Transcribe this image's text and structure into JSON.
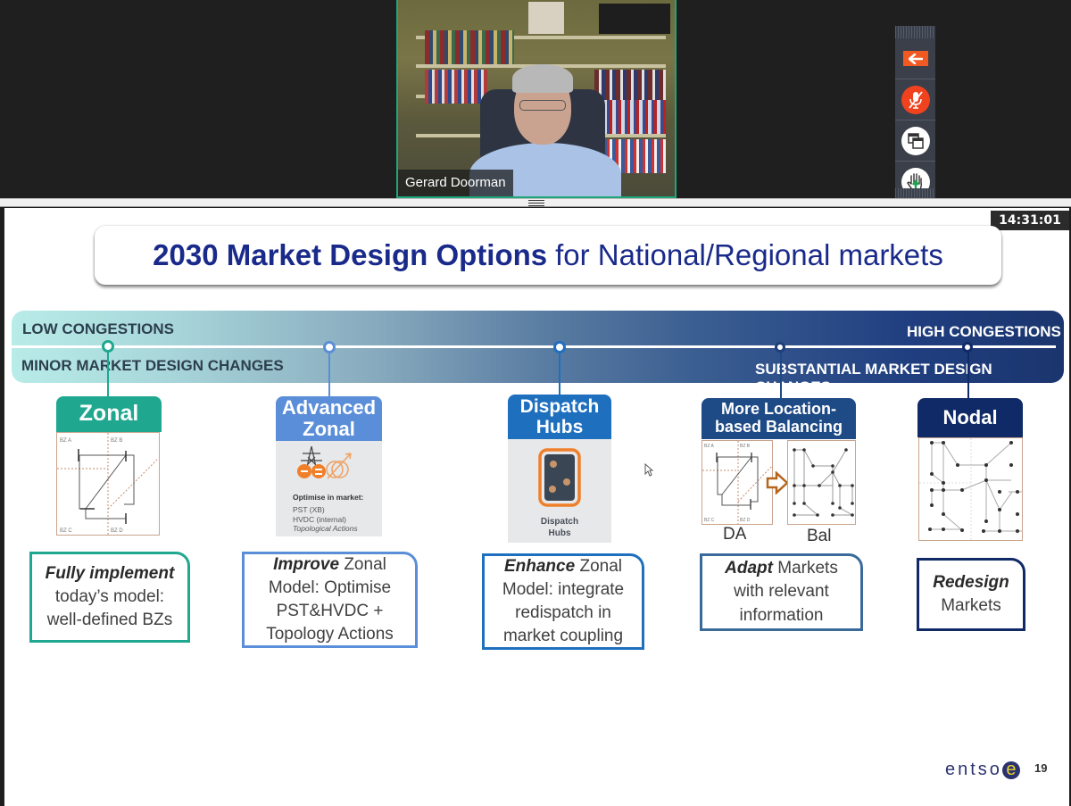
{
  "meeting": {
    "participant_name": "Gerard Doorman",
    "clock": "14:31:01"
  },
  "toolbar": {
    "buttons": [
      {
        "name": "back",
        "icon": "arrow-left-icon"
      },
      {
        "name": "mute",
        "icon": "microphone-muted-icon"
      },
      {
        "name": "switch-view",
        "icon": "windows-icon"
      },
      {
        "name": "raise-hand",
        "icon": "raise-hand-icon"
      }
    ],
    "colors": {
      "back": "#f05a22",
      "mute": "#f0421e",
      "hand_arrow": "#1aa34a"
    }
  },
  "slide": {
    "title_bold": "2030 Market Design Options",
    "title_rest": "for National/Regional markets",
    "band": {
      "top_left": "LOW CONGESTIONS",
      "bottom_left": "MINOR MARKET DESIGN CHANGES",
      "top_right": "HIGH CONGESTIONS",
      "bottom_right": "SUBSTANTIAL MARKET DESIGN CHANGES"
    },
    "options": [
      {
        "header": "Zonal",
        "color": "#1fa88f",
        "diagram_labels": [
          "BZ A",
          "BZ B",
          "BZ C",
          "BZ D"
        ],
        "desc_bold": "Fully implement",
        "desc_rest": [
          "today’s model:",
          "well-defined BZs"
        ]
      },
      {
        "header_line1": "Advanced",
        "header_line2": "Zonal",
        "color": "#5b8ed8",
        "image_caption_bold": "Optimise in market:",
        "image_caption_lines": [
          "PST (XB)",
          "HVDC (internal)"
        ],
        "image_caption_italic": "Topological Actions",
        "desc_bold": "Improve",
        "desc_first_rest": "Zonal",
        "desc_rest": [
          "Model: Optimise",
          "PST&HVDC +",
          "Topology Actions"
        ]
      },
      {
        "header_line1": "Dispatch",
        "header_line2": "Hubs",
        "color": "#1f6fbf",
        "image_caption_line1": "Dispatch",
        "image_caption_line2": "Hubs",
        "desc_bold": "Enhance",
        "desc_first_rest": "Zonal",
        "desc_rest": [
          "Model: integrate",
          "redispatch in",
          "market coupling"
        ]
      },
      {
        "header_line1": "More Location-",
        "header_line2": "based Balancing",
        "color": "#1e4a85",
        "label_left": "DA",
        "label_right": "Bal",
        "diagram_labels": [
          "BZ A",
          "BZ B",
          "BZ C",
          "BZ D"
        ],
        "desc_bold": "Adapt",
        "desc_first_rest": "Markets",
        "desc_rest": [
          "with relevant",
          "information"
        ]
      },
      {
        "header": "Nodal",
        "color": "#0f2a66",
        "desc_bold": "Redesign",
        "desc_rest": [
          "Markets"
        ]
      }
    ],
    "logo_text": "entso",
    "logo_e": "e",
    "page_number": "19"
  }
}
